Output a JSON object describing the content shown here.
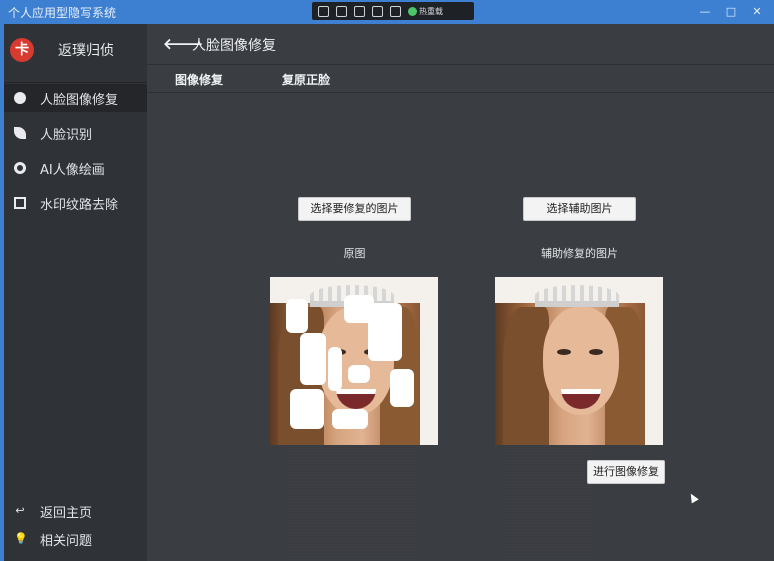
{
  "window": {
    "title": "个人应用型隐写系统",
    "controls": [
      "—",
      "□",
      "✕"
    ]
  },
  "recorder_toolbar": {
    "status_label": "热重载"
  },
  "sidebar": {
    "brand": "返璞归侦",
    "logo_glyph": "卡",
    "items": [
      {
        "label": "人脸图像修复",
        "icon": "dot-icon",
        "active": true
      },
      {
        "label": "人脸识别",
        "icon": "leaf-icon",
        "active": false
      },
      {
        "label": "AI人像绘画",
        "icon": "ring-icon",
        "active": false
      },
      {
        "label": "水印纹路去除",
        "icon": "image-icon",
        "active": false
      }
    ],
    "bottom_items": [
      {
        "label": "返回主页",
        "icon": "back-reply-icon"
      },
      {
        "label": "相关问题",
        "icon": "lightbulb-icon"
      }
    ]
  },
  "main": {
    "back_glyph": "🡐",
    "page_title": "人脸图像修复",
    "tabs": [
      {
        "label": "图像修复"
      },
      {
        "label": "复原正脸"
      }
    ],
    "select_repair_button": "选择要修复的图片",
    "select_aux_button": "选择辅助图片",
    "original_label": "原图",
    "aux_label": "辅助修复的图片",
    "run_button": "进行图像修复"
  },
  "colors": {
    "titlebar": "#3d7fd1",
    "sidebar_bg": "#2f3237",
    "main_bg": "#3a3d42",
    "button_bg": "#f3f3f3"
  }
}
